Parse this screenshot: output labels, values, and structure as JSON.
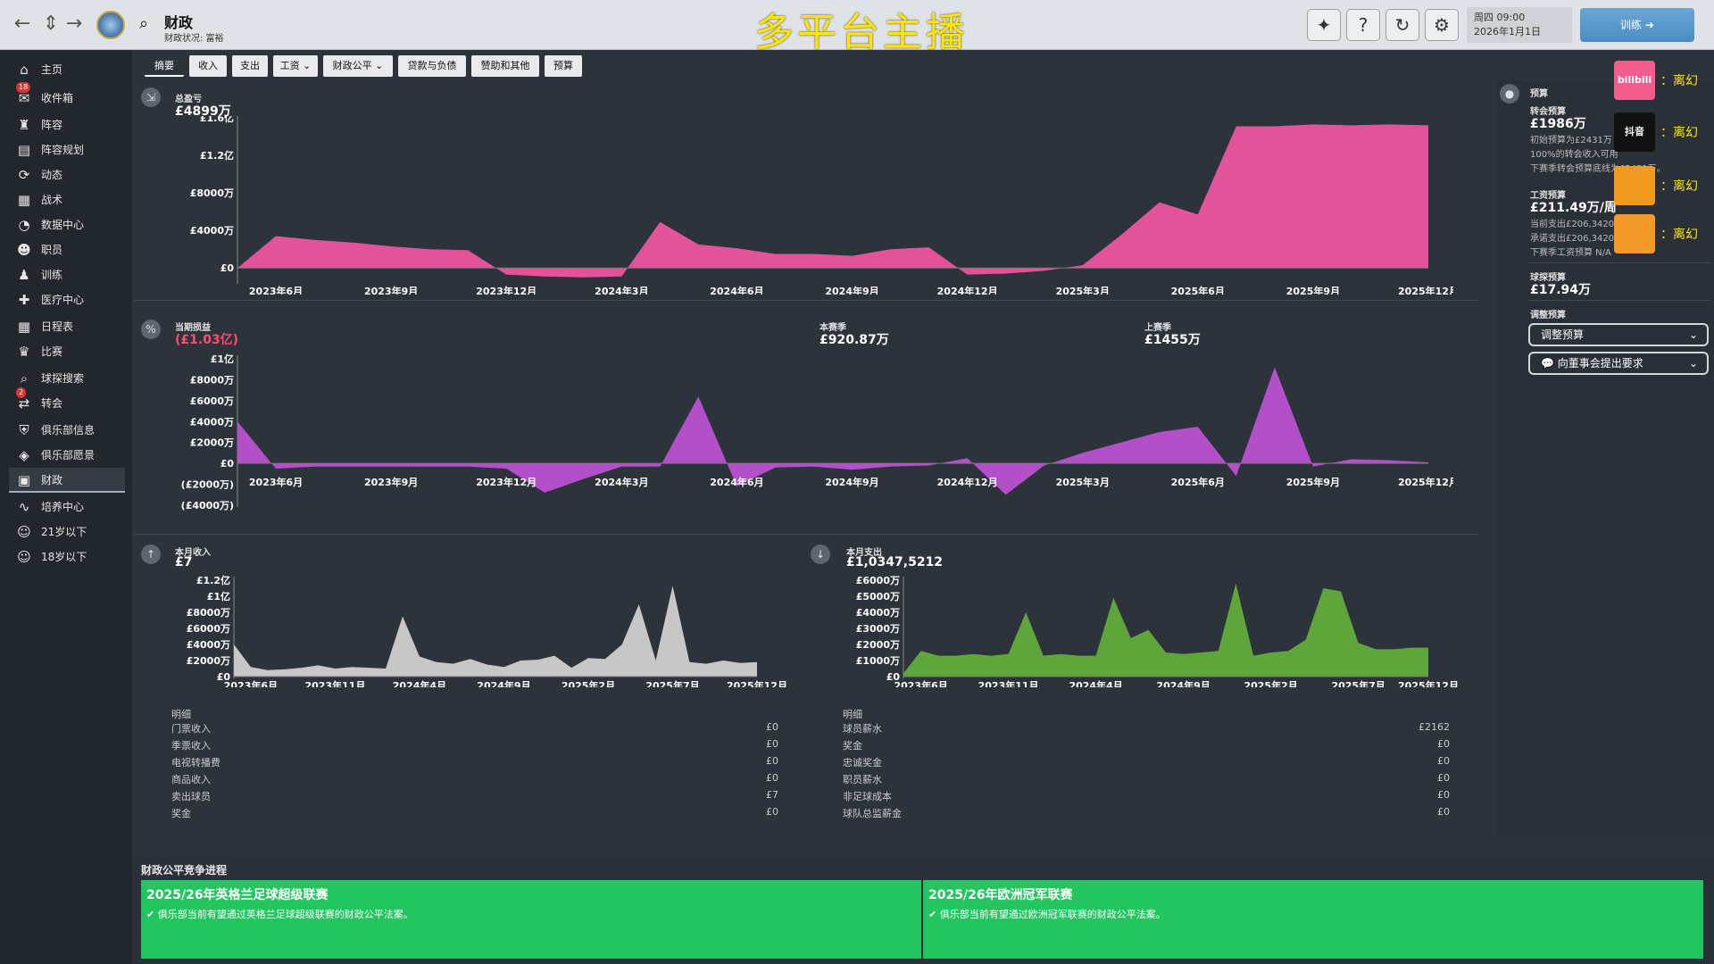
{
  "topbar": {
    "title": "财政",
    "subtitle": "财政状况: 富裕",
    "overlay": "多平台主播",
    "date_line1": "周四 09:00",
    "date_line2": "2026年1月1日",
    "train_label": "训练"
  },
  "sidebar": {
    "items": [
      {
        "label": "主页",
        "icon": "home-icon"
      },
      {
        "label": "收件箱",
        "icon": "inbox-icon",
        "badge": "18"
      },
      {
        "label": "阵容",
        "icon": "shirt-icon"
      },
      {
        "label": "阵容规划",
        "icon": "clipboard-icon"
      },
      {
        "label": "动态",
        "icon": "dynamics-icon"
      },
      {
        "label": "战术",
        "icon": "tactics-icon"
      },
      {
        "label": "数据中心",
        "icon": "data-icon"
      },
      {
        "label": "职员",
        "icon": "staff-icon"
      },
      {
        "label": "训练",
        "icon": "training-icon"
      },
      {
        "label": "医疗中心",
        "icon": "medical-icon"
      },
      {
        "label": "日程表",
        "icon": "calendar-icon"
      },
      {
        "label": "比赛",
        "icon": "trophy-icon"
      },
      {
        "label": "球探搜索",
        "icon": "scout-icon"
      },
      {
        "label": "转会",
        "icon": "transfer-icon",
        "badge": "2"
      },
      {
        "label": "俱乐部信息",
        "icon": "shield-icon"
      },
      {
        "label": "俱乐部愿景",
        "icon": "vision-icon"
      },
      {
        "label": "财政",
        "icon": "finance-icon"
      },
      {
        "label": "培养中心",
        "icon": "development-icon"
      },
      {
        "label": "21岁以下",
        "icon": "u21-icon"
      },
      {
        "label": "18岁以下",
        "icon": "u18-icon"
      }
    ]
  },
  "tabs": [
    "摘要",
    "收入",
    "支出",
    "工资",
    "财政公平",
    "贷款与负债",
    "赞助和其他",
    "预算"
  ],
  "panels": {
    "balance": {
      "label": "总盈亏",
      "value": "£4899万"
    },
    "profit": {
      "label": "当期损益",
      "value": "(£1.03亿)",
      "season_label": "本赛季",
      "season_value": "£920.87万",
      "last_label": "上赛季",
      "last_value": "£1455万"
    },
    "income": {
      "label": "本月收入",
      "value": "£7",
      "detail_header": "明细",
      "rows": [
        [
          "门票收入",
          "£0"
        ],
        [
          "季票收入",
          "£0"
        ],
        [
          "电视转播费",
          "£0"
        ],
        [
          "商品收入",
          "£0"
        ],
        [
          "卖出球员",
          "£7"
        ],
        [
          "奖金",
          "£0"
        ]
      ]
    },
    "expense": {
      "label": "本月支出",
      "value": "£1,0347,5212",
      "detail_header": "明细",
      "rows": [
        [
          "球员薪水",
          "£2162"
        ],
        [
          "奖金",
          "£0"
        ],
        [
          "忠诚奖金",
          "£0"
        ],
        [
          "职员薪水",
          "£0"
        ],
        [
          "非足球成本",
          "£0"
        ],
        [
          "球队总监薪金",
          "£0"
        ]
      ]
    }
  },
  "chart_data": [
    {
      "type": "area",
      "title": "总盈亏",
      "x": [
        "2023年6月",
        "2023年7月",
        "2023年8月",
        "2023年9月",
        "2023年10月",
        "2023年11月",
        "2023年12月",
        "2024年1月",
        "2024年2月",
        "2024年3月",
        "2024年4月",
        "2024年5月",
        "2024年6月",
        "2024年7月",
        "2024年8月",
        "2024年9月",
        "2024年10月",
        "2024年11月",
        "2024年12月",
        "2025年1月",
        "2025年2月",
        "2025年3月",
        "2025年4月",
        "2025年5月",
        "2025年6月",
        "2025年7月",
        "2025年8月",
        "2025年9月",
        "2025年10月",
        "2025年11月",
        "2025年12月"
      ],
      "y_tick_labels": [
        "£0",
        "£4000万",
        "£8000万",
        "£1.2亿",
        "£1.6亿"
      ],
      "x_tick_labels": [
        "2023年6月",
        "2023年9月",
        "2023年12月",
        "2024年3月",
        "2024年6月",
        "2024年9月",
        "2024年12月",
        "2025年3月",
        "2025年6月",
        "2025年9月",
        "2025年12月"
      ],
      "ylim": [
        -1500,
        16000
      ],
      "values": [
        0,
        3400,
        3000,
        2700,
        2300,
        2000,
        1900,
        -700,
        -900,
        -1000,
        -900,
        4900,
        2500,
        2100,
        1500,
        1500,
        1300,
        2000,
        2200,
        -700,
        -600,
        -300,
        300,
        3500,
        7000,
        5700,
        15100,
        15100,
        15300,
        15200,
        15300,
        15200
      ]
    },
    {
      "type": "area",
      "title": "当期损益",
      "x_tick_labels": [
        "2023年6月",
        "2023年9月",
        "2023年12月",
        "2024年3月",
        "2024年6月",
        "2024年9月",
        "2024年12月",
        "2025年3月",
        "2025年6月",
        "2025年9月",
        "2025年12月"
      ],
      "y_tick_labels": [
        "£1亿",
        "£8000万",
        "£6000万",
        "£4000万",
        "£2000万",
        "£0",
        "(£2000万)",
        "(£4000万)"
      ],
      "ylim": [
        -4000,
        10000
      ],
      "values": [
        4000,
        -500,
        -300,
        -300,
        -300,
        -300,
        -300,
        -500,
        -2800,
        -1500,
        -300,
        -300,
        6400,
        -2200,
        -400,
        -300,
        -600,
        -300,
        -200,
        500,
        -3000,
        -200,
        1000,
        2000,
        3000,
        3500,
        -1200,
        9200,
        -300,
        400,
        300,
        100
      ]
    },
    {
      "type": "area",
      "title": "本月收入",
      "x_tick_labels": [
        "2023年6月",
        "2023年11月",
        "2024年4月",
        "2024年9月",
        "2025年2月",
        "2025年7月",
        "2025年12月"
      ],
      "y_tick_labels": [
        "£0",
        "£2000万",
        "£4000万",
        "£6000万",
        "£8000万",
        "£1亿",
        "£1.2亿"
      ],
      "ylim": [
        0,
        12000
      ],
      "values": [
        4000,
        1200,
        800,
        900,
        1100,
        1400,
        1000,
        1200,
        1100,
        1000,
        7500,
        2500,
        1800,
        1600,
        2200,
        1500,
        1200,
        2000,
        2100,
        2600,
        1100,
        2300,
        2200,
        4000,
        9000,
        2000,
        11300,
        1800,
        1600,
        2000,
        1700,
        1800
      ]
    },
    {
      "type": "area",
      "title": "本月支出",
      "x_tick_labels": [
        "2023年6月",
        "2023年11月",
        "2024年4月",
        "2024年9月",
        "2025年2月",
        "2025年7月",
        "2025年12月"
      ],
      "y_tick_labels": [
        "£0",
        "£1000万",
        "£2000万",
        "£3000万",
        "£4000万",
        "£5000万",
        "£6000万"
      ],
      "ylim": [
        0,
        6000
      ],
      "values": [
        200,
        1600,
        1300,
        1300,
        1400,
        1300,
        1400,
        4000,
        1300,
        1400,
        1300,
        1300,
        4900,
        2400,
        2900,
        1500,
        1400,
        1500,
        1600,
        5800,
        1300,
        1500,
        1600,
        2300,
        5500,
        5300,
        2100,
        1700,
        1700,
        1800,
        1800
      ]
    }
  ],
  "right_panel": {
    "budget_label": "预算",
    "transfer_label": "转会预算",
    "transfer_value": "£1986万",
    "transfer_text1": "初始预算为£2431万",
    "transfer_text2": "100%的转会收入可用",
    "transfer_text3": "下赛季转会预算底线为£2431万。",
    "wage_label": "工资预算",
    "wage_value": "£211.49万/周",
    "wage_text1": "当前支出£206,3420/周",
    "wage_text2": "承诺支出£206,3420/周",
    "wage_text3": "下赛季工资预算 N/A",
    "scout_label": "球探预算",
    "scout_value": "£17.94万",
    "adjust_label": "调整预算",
    "adjust_dropdown": "调整预算",
    "board_dropdown": "向董事会提出要求"
  },
  "platforms": [
    {
      "name": "bilibili",
      "caption": "bilibili",
      "status": "：离幻",
      "color": "#f25d8e"
    },
    {
      "name": "douyin",
      "caption": "抖音",
      "status": "：离幻",
      "color": "#111111"
    },
    {
      "name": "huya",
      "caption": "",
      "status": "：离幻",
      "color": "#f09a1f"
    },
    {
      "name": "douyu",
      "caption": "",
      "status": "：离幻",
      "color": "#f39a2b"
    }
  ],
  "fair_play": {
    "title": "财政公平竞争进程",
    "cards": [
      {
        "title": "2025/26年英格兰足球超级联赛",
        "desc": "俱乐部当前有望通过英格兰足球超级联赛的财政公平法案。"
      },
      {
        "title": "2025/26年欧洲冠军联赛",
        "desc": "俱乐部当前有望通过欧洲冠军联赛的财政公平法案。"
      }
    ]
  },
  "colors": {
    "balance": "#e3539a",
    "profit": "#b34fc8",
    "income": "#c7c7c7",
    "expense": "#5fa63a",
    "fairplay": "#22c55e"
  }
}
